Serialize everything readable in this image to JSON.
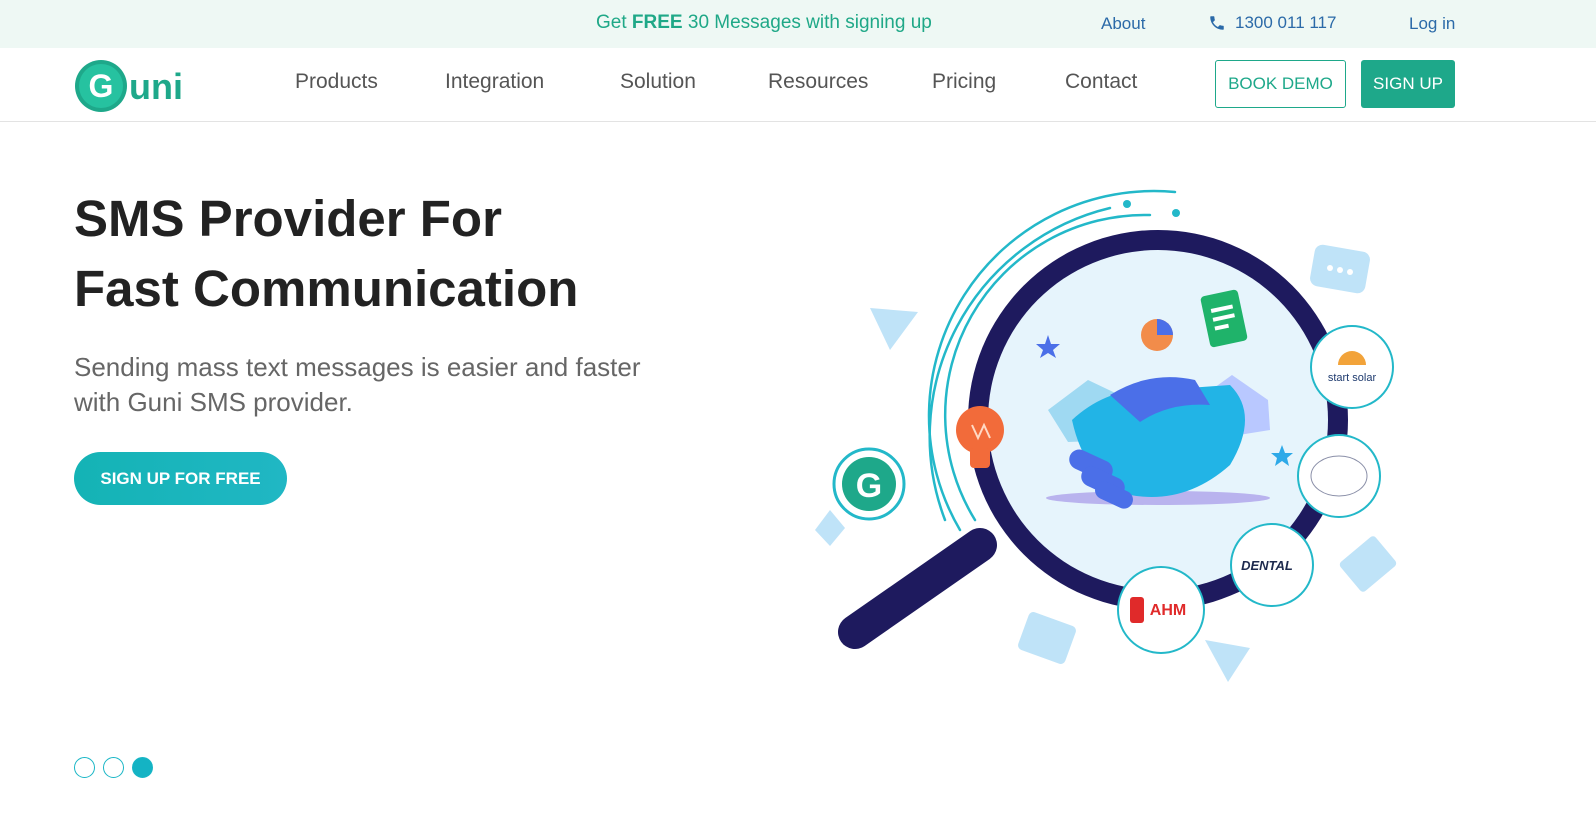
{
  "topbar": {
    "promo_prefix": "Get ",
    "promo_bold": "FREE",
    "promo_suffix": " 30 Messages with signing up",
    "about_label": "About",
    "phone_number": "1300 011 117",
    "login_label": "Log in"
  },
  "brand": {
    "logo_text": "Guni",
    "accent_color": "#1ea88a",
    "cta_color": "#14b3b5"
  },
  "nav": {
    "items": [
      "Products",
      "Integration",
      "Solution",
      "Resources",
      "Pricing",
      "Contact"
    ],
    "book_demo_label": "BOOK DEMO",
    "signup_label": "SIGN UP"
  },
  "hero": {
    "title_line1": "SMS Provider For",
    "title_line2": "Fast Communication",
    "subtitle_line1": "Sending mass text messages is easier and faster",
    "subtitle_line2": "with Guni SMS provider.",
    "cta_label": "SIGN UP FOR FREE"
  },
  "illustration": {
    "client_logos": [
      "start solar",
      "DENTAL",
      "AHM"
    ],
    "icons": [
      "magnifier-icon",
      "handshake-icon",
      "lightbulb-icon",
      "chat-bubble-icon",
      "paper-plane-icon",
      "document-icon",
      "pie-chart-icon",
      "envelope-icon",
      "image-icon",
      "guni-bulb-icon"
    ]
  },
  "carousel": {
    "dot_count": 3,
    "active_index": 2
  }
}
